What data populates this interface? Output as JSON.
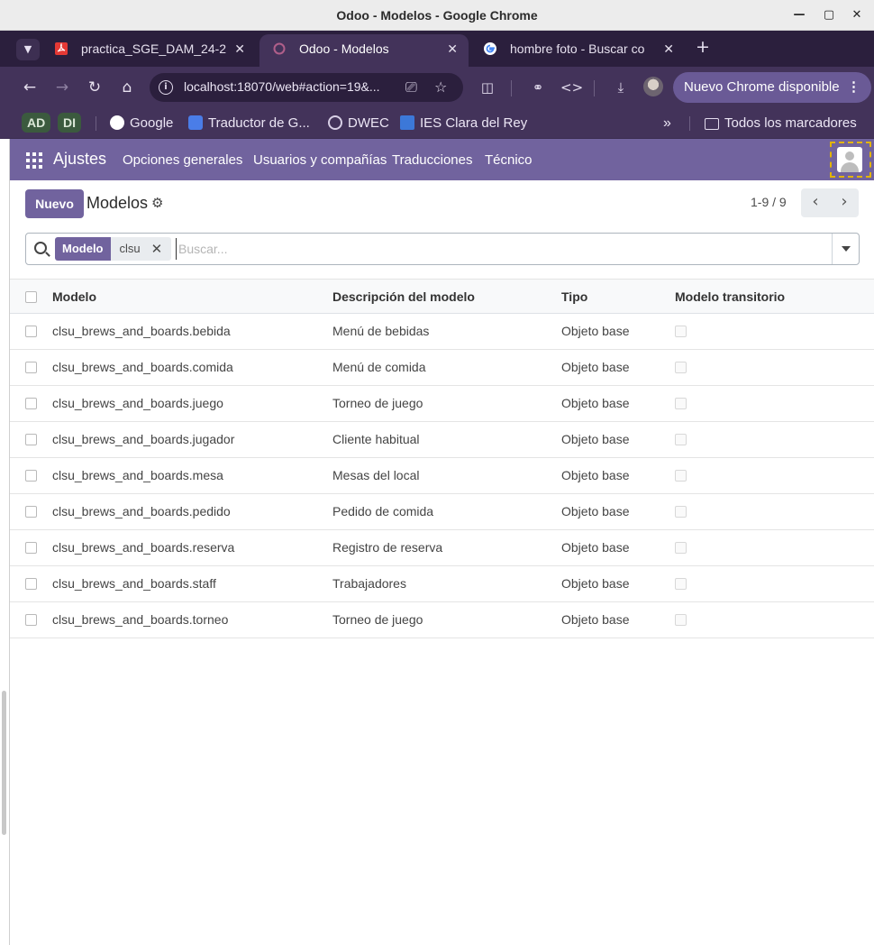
{
  "window": {
    "title": "Odoo - Modelos - Google Chrome"
  },
  "tabs": [
    {
      "label": "practica_SGE_DAM_24-2",
      "icon": "pdf-icon",
      "active": false
    },
    {
      "label": "Odoo - Modelos",
      "icon": "odoo-icon",
      "active": true
    },
    {
      "label": "hombre foto - Buscar co",
      "icon": "google-icon",
      "active": false
    }
  ],
  "toolbar": {
    "url": "localhost:18070/web#action=19&...",
    "update_label": "Nuevo Chrome disponible"
  },
  "bookmarks": {
    "profiles": [
      "AD",
      "DI"
    ],
    "items": [
      {
        "label": "Google",
        "icon": "google-icon"
      },
      {
        "label": "Traductor de G...",
        "icon": "translate-icon"
      },
      {
        "label": "DWEC",
        "icon": "globe-icon"
      },
      {
        "label": "IES Clara del Rey",
        "icon": "school-icon"
      }
    ],
    "overflow": "»",
    "all_bookmarks": "Todos los marcadores"
  },
  "odoo": {
    "app_name": "Ajustes",
    "menu": [
      "Opciones generales",
      "Usuarios y compañías",
      "Traducciones",
      "Técnico"
    ],
    "new_button": "Nuevo",
    "breadcrumb_title": "Modelos",
    "pager": "1-9 / 9",
    "search": {
      "facet_label": "Modelo",
      "facet_value": "clsu",
      "placeholder": "Buscar..."
    },
    "columns": [
      "Modelo",
      "Descripción del modelo",
      "Tipo",
      "Modelo transitorio"
    ],
    "rows": [
      {
        "model": "clsu_brews_and_boards.bebida",
        "description": "Menú de bebidas",
        "type": "Objeto base",
        "transient": false
      },
      {
        "model": "clsu_brews_and_boards.comida",
        "description": "Menú de comida",
        "type": "Objeto base",
        "transient": false
      },
      {
        "model": "clsu_brews_and_boards.juego",
        "description": "Torneo de juego",
        "type": "Objeto base",
        "transient": false
      },
      {
        "model": "clsu_brews_and_boards.jugador",
        "description": "Cliente habitual",
        "type": "Objeto base",
        "transient": false
      },
      {
        "model": "clsu_brews_and_boards.mesa",
        "description": "Mesas del local",
        "type": "Objeto base",
        "transient": false
      },
      {
        "model": "clsu_brews_and_boards.pedido",
        "description": "Pedido de comida",
        "type": "Objeto base",
        "transient": false
      },
      {
        "model": "clsu_brews_and_boards.reserva",
        "description": "Registro de reserva",
        "type": "Objeto base",
        "transient": false
      },
      {
        "model": "clsu_brews_and_boards.staff",
        "description": "Trabajadores",
        "type": "Objeto base",
        "transient": false
      },
      {
        "model": "clsu_brews_and_boards.torneo",
        "description": "Torneo de juego",
        "type": "Objeto base",
        "transient": false
      }
    ]
  },
  "colors": {
    "odoo_primary": "#71639e",
    "chrome_frame": "#2b1f3d",
    "chrome_toolbar": "#43335a"
  }
}
